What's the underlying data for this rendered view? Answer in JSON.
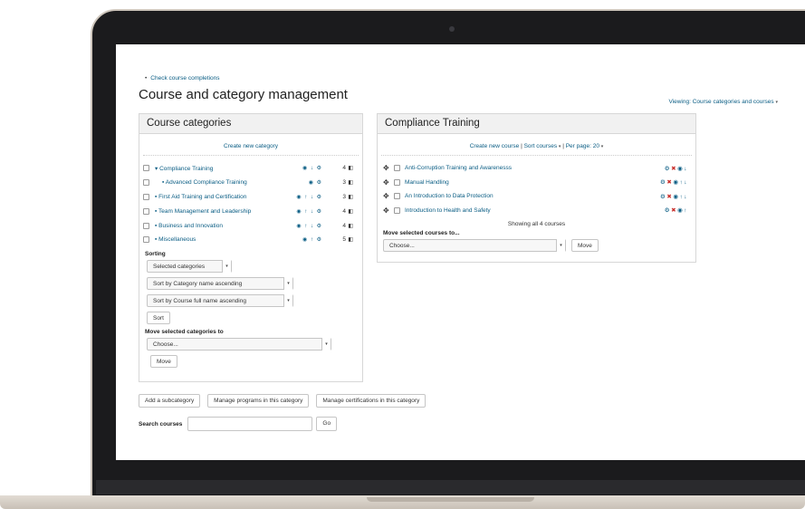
{
  "page": {
    "check_link": "Check course completions",
    "title": "Course and category management",
    "viewing": "Viewing: Course categories and courses"
  },
  "categories_panel": {
    "heading": "Course categories",
    "create_link": "Create new category",
    "items": [
      {
        "name": "Compliance Training",
        "count": "4",
        "expanded": true,
        "sub": false,
        "icons": "◉ ↓ ⚙"
      },
      {
        "name": "Advanced Compliance Training",
        "count": "3",
        "expanded": false,
        "sub": true,
        "icons": "◉ ⚙"
      },
      {
        "name": "First Aid Training and Certification",
        "count": "3",
        "expanded": false,
        "sub": false,
        "icons": "◉ ↑ ↓ ⚙"
      },
      {
        "name": "Team Management and Leadership",
        "count": "4",
        "expanded": false,
        "sub": false,
        "icons": "◉ ↑ ↓ ⚙"
      },
      {
        "name": "Business and Innovation",
        "count": "4",
        "expanded": false,
        "sub": false,
        "icons": "◉ ↑ ↓ ⚙"
      },
      {
        "name": "Miscellaneous",
        "count": "5",
        "expanded": false,
        "sub": false,
        "icons": "◉ ↑ ⚙"
      }
    ],
    "sorting_label": "Sorting",
    "sorting_scope": "Selected categories",
    "sort_by_category": "Sort by Category name ascending",
    "sort_by_course": "Sort by Course full name ascending",
    "sort_button": "Sort",
    "move_label": "Move selected categories to",
    "move_choose": "Choose...",
    "move_button": "Move"
  },
  "courses_panel": {
    "heading": "Compliance Training",
    "create_course": "Create new course",
    "sort_courses": "Sort courses",
    "per_page": "Per page: 20",
    "courses": [
      {
        "name": "Anti-Corruption Training and Awarenesss",
        "icons": "⚙ ✖ ◉ ↓"
      },
      {
        "name": "Manual Handling",
        "icons": "⚙ ✖ ◉ ↑ ↓"
      },
      {
        "name": "An Introduction to Data Protection",
        "icons": "⚙ ✖ ◉ ↑ ↓"
      },
      {
        "name": "Introduction to Health and Safety",
        "icons": "⚙ ✖ ◉ ↑"
      }
    ],
    "showing": "Showing all 4 courses",
    "move_label": "Move selected courses to...",
    "move_choose": "Choose...",
    "move_button": "Move"
  },
  "actions": {
    "add_subcategory": "Add a subcategory",
    "manage_programs": "Manage programs in this category",
    "manage_certifications": "Manage certifications in this category"
  },
  "search": {
    "label": "Search courses",
    "value": "",
    "go": "Go"
  },
  "colors": {
    "link": "#0a5d84",
    "delete": "#c9302c",
    "panel_header": "#f1f1f1"
  }
}
